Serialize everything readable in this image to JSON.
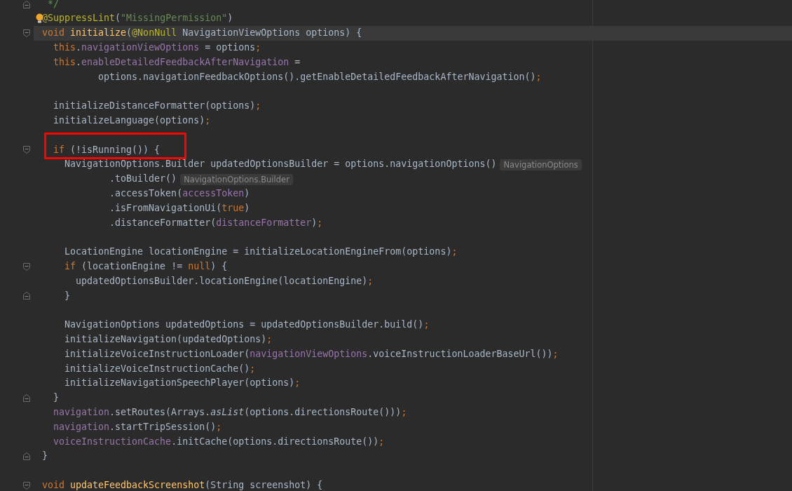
{
  "editor": {
    "lines": [
      {
        "fold_end": true,
        "tokens": [
          {
            "kind": "comment",
            "text": " */"
          }
        ]
      },
      {
        "bulb": true,
        "tokens": [
          {
            "kind": "annotation",
            "text": "@SuppressLint"
          },
          {
            "kind": "plain",
            "text": "("
          },
          {
            "kind": "string",
            "text": "\"MissingPermission\""
          },
          {
            "kind": "plain",
            "text": ")"
          }
        ]
      },
      {
        "current": true,
        "fold_start": true,
        "tokens": [
          {
            "kind": "keyword",
            "text": "void "
          },
          {
            "kind": "method",
            "text": "initialize"
          },
          {
            "kind": "plain",
            "text": "("
          },
          {
            "kind": "annotation",
            "text": "@NonNull"
          },
          {
            "kind": "plain",
            "text": " NavigationViewOptions options) {"
          }
        ]
      },
      {
        "tokens": [
          {
            "kind": "keyword",
            "text": "  this"
          },
          {
            "kind": "plain",
            "text": "."
          },
          {
            "kind": "field",
            "text": "navigationViewOptions"
          },
          {
            "kind": "plain",
            "text": " = options"
          },
          {
            "kind": "keyword",
            "text": ";"
          }
        ]
      },
      {
        "tokens": [
          {
            "kind": "keyword",
            "text": "  this"
          },
          {
            "kind": "plain",
            "text": "."
          },
          {
            "kind": "field",
            "text": "enableDetailedFeedbackAfterNavigation"
          },
          {
            "kind": "plain",
            "text": " ="
          }
        ]
      },
      {
        "tokens": [
          {
            "kind": "plain",
            "text": "          options.navigationFeedbackOptions().getEnableDetailedFeedbackAfterNavigation()"
          },
          {
            "kind": "keyword",
            "text": ";"
          }
        ]
      },
      {
        "blank_before": true,
        "tokens": [
          {
            "kind": "plain",
            "text": "  initializeDistanceFormatter(options)"
          },
          {
            "kind": "keyword",
            "text": ";"
          }
        ]
      },
      {
        "tokens": [
          {
            "kind": "plain",
            "text": "  initializeLanguage(options)"
          },
          {
            "kind": "keyword",
            "text": ";"
          }
        ]
      },
      {
        "blank_before": true,
        "boxed": true,
        "fold_start": true,
        "tokens": [
          {
            "kind": "keyword",
            "text": "  if "
          },
          {
            "kind": "plain",
            "text": "(!isRunning()) {"
          }
        ]
      },
      {
        "hint": "NavigationOptions",
        "tokens": [
          {
            "kind": "plain",
            "text": "    NavigationOptions.Builder updatedOptionsBuilder = options.navigationOptions()"
          }
        ]
      },
      {
        "hint": "NavigationOptions.Builder",
        "tokens": [
          {
            "kind": "plain",
            "text": "            .toBuilder()"
          }
        ]
      },
      {
        "tokens": [
          {
            "kind": "plain",
            "text": "            .accessToken("
          },
          {
            "kind": "field",
            "text": "accessToken"
          },
          {
            "kind": "plain",
            "text": ")"
          }
        ]
      },
      {
        "tokens": [
          {
            "kind": "plain",
            "text": "            .isFromNavigationUi("
          },
          {
            "kind": "keyword",
            "text": "true"
          },
          {
            "kind": "plain",
            "text": ")"
          }
        ]
      },
      {
        "tokens": [
          {
            "kind": "plain",
            "text": "            .distanceFormatter("
          },
          {
            "kind": "field",
            "text": "distanceFormatter"
          },
          {
            "kind": "plain",
            "text": ")"
          },
          {
            "kind": "keyword",
            "text": ";"
          }
        ]
      },
      {
        "blank_before": true,
        "tokens": [
          {
            "kind": "plain",
            "text": "    LocationEngine locationEngine = initializeLocationEngineFrom(options)"
          },
          {
            "kind": "keyword",
            "text": ";"
          }
        ]
      },
      {
        "fold_start": true,
        "tokens": [
          {
            "kind": "keyword",
            "text": "    if "
          },
          {
            "kind": "plain",
            "text": "(locationEngine != "
          },
          {
            "kind": "keyword",
            "text": "null"
          },
          {
            "kind": "plain",
            "text": ") {"
          }
        ]
      },
      {
        "tokens": [
          {
            "kind": "plain",
            "text": "      updatedOptionsBuilder.locationEngine(locationEngine)"
          },
          {
            "kind": "keyword",
            "text": ";"
          }
        ]
      },
      {
        "fold_end": true,
        "tokens": [
          {
            "kind": "plain",
            "text": "    }"
          }
        ]
      },
      {
        "blank_before": true,
        "tokens": [
          {
            "kind": "plain",
            "text": "    NavigationOptions updatedOptions = updatedOptionsBuilder.build()"
          },
          {
            "kind": "keyword",
            "text": ";"
          }
        ]
      },
      {
        "tokens": [
          {
            "kind": "plain",
            "text": "    initializeNavigation(updatedOptions)"
          },
          {
            "kind": "keyword",
            "text": ";"
          }
        ]
      },
      {
        "tokens": [
          {
            "kind": "plain",
            "text": "    initializeVoiceInstructionLoader("
          },
          {
            "kind": "field",
            "text": "navigationViewOptions"
          },
          {
            "kind": "plain",
            "text": ".voiceInstructionLoaderBaseUrl())"
          },
          {
            "kind": "keyword",
            "text": ";"
          }
        ]
      },
      {
        "tokens": [
          {
            "kind": "plain",
            "text": "    initializeVoiceInstructionCache()"
          },
          {
            "kind": "keyword",
            "text": ";"
          }
        ]
      },
      {
        "tokens": [
          {
            "kind": "plain",
            "text": "    initializeNavigationSpeechPlayer(options)"
          },
          {
            "kind": "keyword",
            "text": ";"
          }
        ]
      },
      {
        "fold_end": true,
        "tokens": [
          {
            "kind": "plain",
            "text": "  }"
          }
        ]
      },
      {
        "tokens": [
          {
            "kind": "field",
            "text": "  navigation"
          },
          {
            "kind": "plain",
            "text": ".setRoutes(Arrays."
          },
          {
            "kind": "static",
            "text": "asList"
          },
          {
            "kind": "plain",
            "text": "(options.directionsRoute()))"
          },
          {
            "kind": "keyword",
            "text": ";"
          }
        ]
      },
      {
        "tokens": [
          {
            "kind": "field",
            "text": "  navigation"
          },
          {
            "kind": "plain",
            "text": ".startTripSession()"
          },
          {
            "kind": "keyword",
            "text": ";"
          }
        ]
      },
      {
        "tokens": [
          {
            "kind": "field",
            "text": "  voiceInstructionCache"
          },
          {
            "kind": "plain",
            "text": ".initCache(options.directionsRoute())"
          },
          {
            "kind": "keyword",
            "text": ";"
          }
        ]
      },
      {
        "fold_end": true,
        "tokens": [
          {
            "kind": "plain",
            "text": "}"
          }
        ]
      },
      {
        "blank_before": true,
        "fold_start": true,
        "tokens": [
          {
            "kind": "keyword",
            "text": "void "
          },
          {
            "kind": "method",
            "text": "updateFeedbackScreenshot"
          },
          {
            "kind": "plain",
            "text": "(String screenshot) {"
          }
        ]
      }
    ]
  }
}
